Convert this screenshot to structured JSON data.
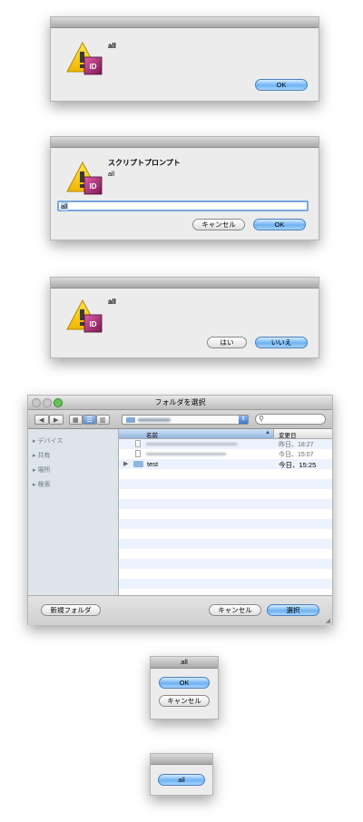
{
  "dialog1": {
    "message": "all",
    "ok_label": "OK"
  },
  "dialog2": {
    "title": "スクリプトプロンプト",
    "prompt": "all",
    "input_value": "all",
    "cancel_label": "キャンセル",
    "ok_label": "OK"
  },
  "dialog3": {
    "message": "all",
    "yes_label": "はい",
    "no_label": "いいえ"
  },
  "folder_dialog": {
    "title": "フォルダを選択",
    "sidebar": [
      {
        "label": "デバイス"
      },
      {
        "label": "共有"
      },
      {
        "label": "場所"
      },
      {
        "label": "検索"
      }
    ],
    "columns": {
      "name": "名前",
      "date": "変更日"
    },
    "files": [
      {
        "date": "昨日、18:27",
        "type": "file"
      },
      {
        "date": "今日、15:07",
        "type": "file"
      },
      {
        "name": "test",
        "date": "今日、15:25",
        "type": "folder"
      }
    ],
    "new_folder_label": "新規フォルダ",
    "cancel_label": "キャンセル",
    "choose_label": "選択"
  },
  "dialog5": {
    "title": "all",
    "ok_label": "OK",
    "cancel_label": "キャンセル"
  },
  "dialog6": {
    "button_label": "all"
  },
  "icons": {
    "app_icon": "indesign-warning-icon"
  }
}
